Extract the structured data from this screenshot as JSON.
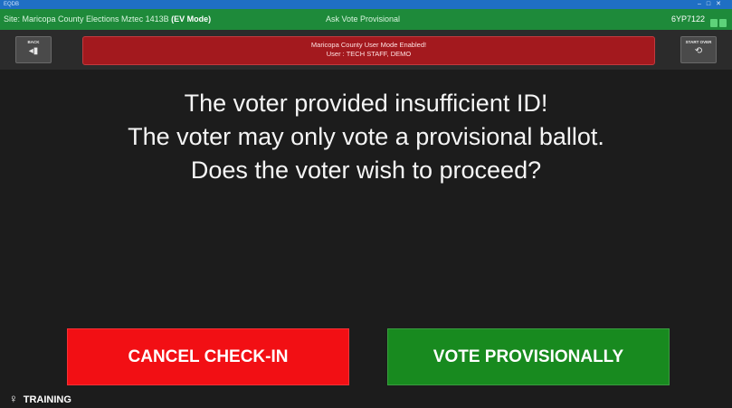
{
  "window": {
    "app_label": "EQDB",
    "controls": [
      "–",
      "□",
      "✕"
    ]
  },
  "infobar": {
    "site_prefix": "Site: Maricopa County Elections Mztec 1413B",
    "mode": "(EV Mode)",
    "screen_title": "Ask Vote Provisional",
    "code": "6YP7122",
    "status_color": "#5ed27a"
  },
  "header": {
    "back_label": "BACK",
    "back_icon": "back-arrow-icon",
    "start_over_label": "START OVER",
    "start_over_icon": "restart-icon",
    "alert_line1": "Maricopa County User Mode Enabled!",
    "alert_line2": "User : TECH STAFF, DEMO"
  },
  "message": {
    "line1": "The voter provided insufficient ID!",
    "line2": "The voter may only vote a provisional ballot.",
    "line3": "Does the voter wish to proceed?"
  },
  "actions": {
    "cancel_label": "CANCEL CHECK-IN",
    "cancel_color": "#f20f14",
    "provisional_label": "VOTE PROVISIONALLY",
    "provisional_color": "#188a1f"
  },
  "footer": {
    "training_label": "TRAINING",
    "training_icon": "lightbulb-icon"
  }
}
